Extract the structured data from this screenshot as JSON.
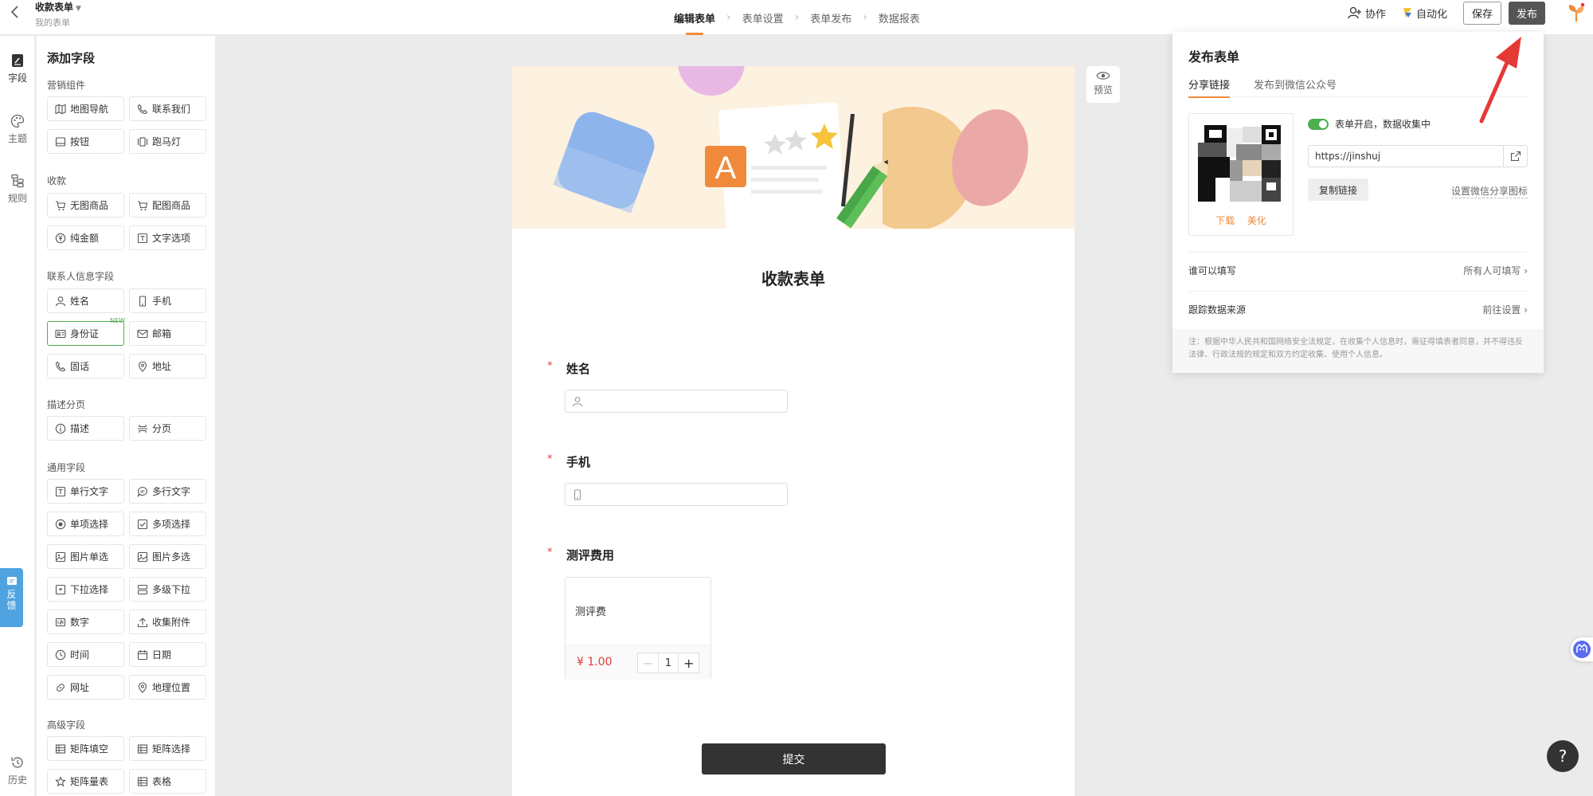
{
  "header": {
    "form_name": "收款表单",
    "subtitle": "我的表单",
    "steps": [
      "编辑表单",
      "表单设置",
      "表单发布",
      "数据报表"
    ],
    "collab_label": "协作",
    "automation_label": "自动化",
    "save_label": "保存",
    "publish_label": "发布"
  },
  "rail": {
    "fields": "字段",
    "theme": "主题",
    "rules": "规则",
    "history": "历史"
  },
  "field_panel": {
    "title": "添加字段",
    "sections": [
      {
        "title": "营销组件",
        "items": [
          "地图导航",
          "联系我们",
          "按钮",
          "跑马灯"
        ]
      },
      {
        "title": "收款",
        "items": [
          "无图商品",
          "配图商品",
          "纯金额",
          "文字选项"
        ]
      },
      {
        "title": "联系人信息字段",
        "items": [
          "姓名",
          "手机",
          "身份证",
          "邮箱",
          "固话",
          "地址"
        ]
      },
      {
        "title": "描述分页",
        "items": [
          "描述",
          "分页"
        ]
      },
      {
        "title": "通用字段",
        "items": [
          "单行文字",
          "多行文字",
          "单项选择",
          "多项选择",
          "图片单选",
          "图片多选",
          "下拉选择",
          "多级下拉",
          "数字",
          "收集附件",
          "时间",
          "日期",
          "网址",
          "地理位置"
        ]
      },
      {
        "title": "高级字段",
        "items": [
          "矩阵填空",
          "矩阵选择",
          "矩阵量表",
          "表格"
        ]
      }
    ],
    "new_badge": "NEW"
  },
  "feedback": {
    "line1": "反",
    "line2": "馈"
  },
  "form": {
    "title": "收款表单",
    "questions": [
      {
        "label": "姓名",
        "required": "*"
      },
      {
        "label": "手机",
        "required": "*"
      },
      {
        "label": "测评费用",
        "required": "*"
      }
    ],
    "product": {
      "name": "测评费",
      "price": "¥ 1.00",
      "minus": "−",
      "qty": "1",
      "plus": "+"
    },
    "submit_label": "提交"
  },
  "preview_label": "预览",
  "publish_panel": {
    "title": "发布表单",
    "tabs": [
      "分享链接",
      "发布到微信公众号"
    ],
    "qr_download": "下载",
    "qr_beautify": "美化",
    "toggle_text": "表单开启，数据收集中",
    "url": "https://jinshuj",
    "copy_label": "复制链接",
    "wx_icon_label": "设置微信分享图标",
    "who_can_fill": {
      "label": "谁可以填写",
      "value": "所有人可填写"
    },
    "track_source": {
      "label": "跟踪数据来源",
      "value": "前往设置"
    },
    "note": "注：根据中华人民共和国网络安全法规定，在收集个人信息时，需征得填表者同意，并不得违反法律、行政法规的规定和双方约定收集、使用个人信息。"
  },
  "help_label": "?",
  "colors": {
    "accent": "#f08a3a",
    "toggle": "#4caf50",
    "required": "#e53935",
    "feedback": "#4fa3e0"
  }
}
